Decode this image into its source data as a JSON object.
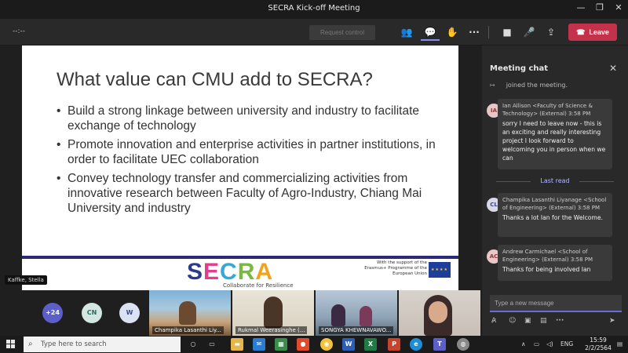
{
  "window": {
    "title": "SECRA Kick-off Meeting"
  },
  "toolbar": {
    "timer": "--:--",
    "request_control": "Request control",
    "leave": "Leave"
  },
  "slide": {
    "title": "What value can CMU add to SECRA?",
    "bullets": [
      "Build a strong linkage between university and industry to facilitate exchange of technology",
      "Promote innovation and enterprise activities in partner institutions, in order to facilitate UEC collaboration",
      "Convey technology transfer and commercializing activities from innovative research between Faculty of Agro-Industry, Chiang Mai University and industry"
    ],
    "logo": "SECRA",
    "logo_colors": [
      "#2d3a8c",
      "#e63c8a",
      "#3aa6d8",
      "#7bb842",
      "#f2a31c"
    ],
    "tagline": "Collaborate for Resilience",
    "eu_text": "With the support of the Erasmus+ Programme of the European Union",
    "presenter": "Kaffke, Stella"
  },
  "chat": {
    "header": "Meeting chat",
    "joined": "joined the meeting.",
    "last_read": "Last read",
    "messages": [
      {
        "initials": "IA",
        "meta": "Ian Allison <Faculty of Science & Technology> (External)  3:58 PM",
        "body": "sorry I need to leave now - this is an exciting and really interesting project I look forward to welcoming you in person when we can"
      },
      {
        "initials": "CL",
        "meta": "Champika Lasanthi Liyanage <School of Engineering> (External)  3:58 PM",
        "body": "Thanks a lot Ian for the Welcome."
      },
      {
        "initials": "AC",
        "meta": "Andrew Carmichael <School of Engineering> (External)  3:58 PM",
        "body": "Thanks for being involved Ian"
      }
    ],
    "compose_placeholder": "Type a new message"
  },
  "gallery": {
    "avatars": [
      {
        "label": "+24",
        "color": "#5b5fc7",
        "text_color": "#ffffff"
      },
      {
        "label": "CN",
        "color": "#d3e6e1",
        "text_color": "#2b6b5e"
      },
      {
        "label": "W",
        "color": "#dbe3f3",
        "text_color": "#3b4d87"
      }
    ],
    "tiles": [
      {
        "name": "Champika Lasanthi Liy..."
      },
      {
        "name": "Rukmal Weerasinghe (..."
      },
      {
        "name": "SONGYA KHEWNAVAWO..."
      },
      {
        "name": ""
      }
    ]
  },
  "taskbar": {
    "search_placeholder": "Type here to search",
    "lang": "ENG",
    "time": "15:59",
    "date": "2/2/2564"
  }
}
